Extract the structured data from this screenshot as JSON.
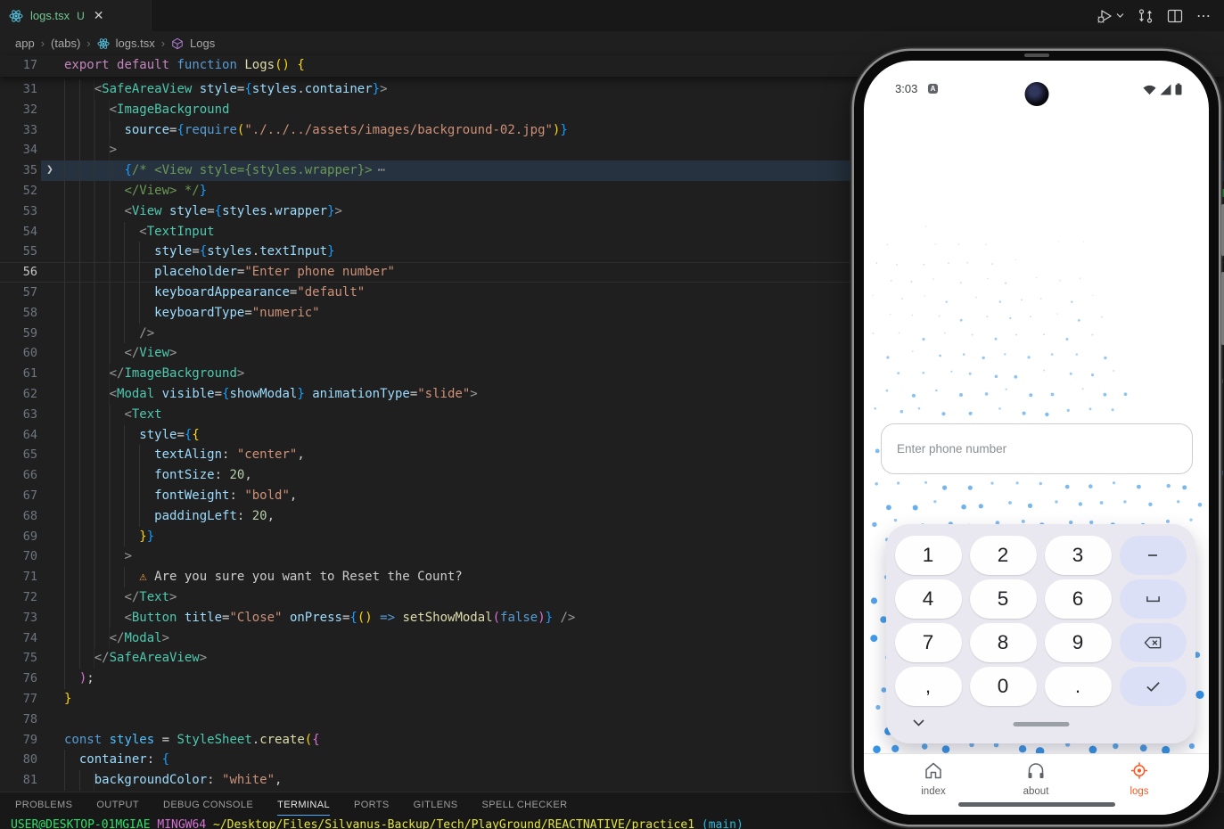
{
  "window": {
    "tab": {
      "title": "logs.tsx",
      "badge": "U",
      "close_glyph": "✕"
    },
    "editor_actions": [
      "run-or-debug",
      "open-changes",
      "split-editor",
      "more-actions"
    ]
  },
  "breadcrumb": {
    "items": [
      "app",
      "(tabs)",
      "logs.tsx",
      "Logs"
    ],
    "separator": "›"
  },
  "editor": {
    "sticky_line": {
      "n": 17,
      "t": [
        [
          "kw1",
          "export"
        ],
        [
          "pln",
          " "
        ],
        [
          "kw1",
          "default"
        ],
        [
          "pln",
          " "
        ],
        [
          "kw2",
          "function"
        ],
        [
          "pln",
          " "
        ],
        [
          "fn",
          "Logs"
        ],
        [
          "br1",
          "()"
        ],
        [
          "pln",
          " "
        ],
        [
          "br1",
          "{"
        ]
      ]
    },
    "lines": [
      {
        "n": 31,
        "t": [
          [
            "ws",
            "    "
          ],
          [
            "pun",
            "<"
          ],
          [
            "cmp",
            "SafeAreaView"
          ],
          [
            "pln",
            " "
          ],
          [
            "attr",
            "style"
          ],
          [
            "pln",
            "="
          ],
          [
            "br3",
            "{"
          ],
          [
            "var",
            "styles"
          ],
          [
            "pln",
            "."
          ],
          [
            "var",
            "container"
          ],
          [
            "br3",
            "}"
          ],
          [
            "pun",
            ">"
          ]
        ]
      },
      {
        "n": 32,
        "t": [
          [
            "ws",
            "      "
          ],
          [
            "pun",
            "<"
          ],
          [
            "cmp",
            "ImageBackground"
          ]
        ]
      },
      {
        "n": 33,
        "t": [
          [
            "ws",
            "        "
          ],
          [
            "attr",
            "source"
          ],
          [
            "pln",
            "="
          ],
          [
            "br3",
            "{"
          ],
          [
            "kw2",
            "require"
          ],
          [
            "br1",
            "("
          ],
          [
            "str",
            "\"./../../assets/images/background-02.jpg\""
          ],
          [
            "br1",
            ")"
          ],
          [
            "br3",
            "}"
          ]
        ]
      },
      {
        "n": 34,
        "t": [
          [
            "ws",
            "      "
          ],
          [
            "pun",
            ">"
          ]
        ]
      },
      {
        "n": 35,
        "f": true,
        "h": true,
        "t": [
          [
            "ws",
            "        "
          ],
          [
            "br3",
            "{"
          ],
          [
            "cmt",
            "/* <View style={styles.wrapper}>"
          ],
          [
            "fold",
            "⋯"
          ]
        ]
      },
      {
        "n": 52,
        "t": [
          [
            "ws",
            "        "
          ],
          [
            "cmt",
            "</View> */"
          ],
          [
            "br3",
            "}"
          ]
        ]
      },
      {
        "n": 53,
        "t": [
          [
            "ws",
            "        "
          ],
          [
            "pun",
            "<"
          ],
          [
            "cmp",
            "View"
          ],
          [
            "pln",
            " "
          ],
          [
            "attr",
            "style"
          ],
          [
            "pln",
            "="
          ],
          [
            "br3",
            "{"
          ],
          [
            "var",
            "styles"
          ],
          [
            "pln",
            "."
          ],
          [
            "var",
            "wrapper"
          ],
          [
            "br3",
            "}"
          ],
          [
            "pun",
            ">"
          ]
        ]
      },
      {
        "n": 54,
        "t": [
          [
            "ws",
            "          "
          ],
          [
            "pun",
            "<"
          ],
          [
            "cmp",
            "TextInput"
          ]
        ]
      },
      {
        "n": 55,
        "t": [
          [
            "ws",
            "            "
          ],
          [
            "attr",
            "style"
          ],
          [
            "pln",
            "="
          ],
          [
            "br3",
            "{"
          ],
          [
            "var",
            "styles"
          ],
          [
            "pln",
            "."
          ],
          [
            "var",
            "textInput"
          ],
          [
            "br3",
            "}"
          ]
        ]
      },
      {
        "n": 56,
        "c": true,
        "t": [
          [
            "ws",
            "            "
          ],
          [
            "attr",
            "placeholder"
          ],
          [
            "pln",
            "="
          ],
          [
            "str",
            "\"Enter phone number\""
          ]
        ]
      },
      {
        "n": 57,
        "t": [
          [
            "ws",
            "            "
          ],
          [
            "attr",
            "keyboardAppearance"
          ],
          [
            "pln",
            "="
          ],
          [
            "str",
            "\"default\""
          ]
        ]
      },
      {
        "n": 58,
        "t": [
          [
            "ws",
            "            "
          ],
          [
            "attr",
            "keyboardType"
          ],
          [
            "pln",
            "="
          ],
          [
            "str",
            "\"numeric\""
          ]
        ]
      },
      {
        "n": 59,
        "t": [
          [
            "ws",
            "          "
          ],
          [
            "pun",
            "/>"
          ]
        ]
      },
      {
        "n": 60,
        "t": [
          [
            "ws",
            "        "
          ],
          [
            "pun",
            "</"
          ],
          [
            "cmp",
            "View"
          ],
          [
            "pun",
            ">"
          ]
        ]
      },
      {
        "n": 61,
        "t": [
          [
            "ws",
            "      "
          ],
          [
            "pun",
            "</"
          ],
          [
            "cmp",
            "ImageBackground"
          ],
          [
            "pun",
            ">"
          ]
        ]
      },
      {
        "n": 62,
        "t": [
          [
            "ws",
            "      "
          ],
          [
            "pun",
            "<"
          ],
          [
            "cmp",
            "Modal"
          ],
          [
            "pln",
            " "
          ],
          [
            "attr",
            "visible"
          ],
          [
            "pln",
            "="
          ],
          [
            "br3",
            "{"
          ],
          [
            "var",
            "showModal"
          ],
          [
            "br3",
            "}"
          ],
          [
            "pln",
            " "
          ],
          [
            "attr",
            "animationType"
          ],
          [
            "pln",
            "="
          ],
          [
            "str",
            "\"slide\""
          ],
          [
            "pun",
            ">"
          ]
        ]
      },
      {
        "n": 63,
        "t": [
          [
            "ws",
            "        "
          ],
          [
            "pun",
            "<"
          ],
          [
            "cmp",
            "Text"
          ]
        ]
      },
      {
        "n": 64,
        "t": [
          [
            "ws",
            "          "
          ],
          [
            "attr",
            "style"
          ],
          [
            "pln",
            "="
          ],
          [
            "br3",
            "{"
          ],
          [
            "br1",
            "{"
          ]
        ]
      },
      {
        "n": 65,
        "t": [
          [
            "ws",
            "            "
          ],
          [
            "attr",
            "textAlign"
          ],
          [
            "pln",
            ": "
          ],
          [
            "str",
            "\"center\""
          ],
          [
            "pln",
            ","
          ]
        ]
      },
      {
        "n": 66,
        "t": [
          [
            "ws",
            "            "
          ],
          [
            "attr",
            "fontSize"
          ],
          [
            "pln",
            ": "
          ],
          [
            "num",
            "20"
          ],
          [
            "pln",
            ","
          ]
        ]
      },
      {
        "n": 67,
        "t": [
          [
            "ws",
            "            "
          ],
          [
            "attr",
            "fontWeight"
          ],
          [
            "pln",
            ": "
          ],
          [
            "str",
            "\"bold\""
          ],
          [
            "pln",
            ","
          ]
        ]
      },
      {
        "n": 68,
        "t": [
          [
            "ws",
            "            "
          ],
          [
            "attr",
            "paddingLeft"
          ],
          [
            "pln",
            ": "
          ],
          [
            "num",
            "20"
          ],
          [
            "pln",
            ","
          ]
        ]
      },
      {
        "n": 69,
        "t": [
          [
            "ws",
            "          "
          ],
          [
            "br1",
            "}"
          ],
          [
            "br3",
            "}"
          ]
        ]
      },
      {
        "n": 70,
        "t": [
          [
            "ws",
            "        "
          ],
          [
            "pun",
            ">"
          ]
        ]
      },
      {
        "n": 71,
        "t": [
          [
            "ws",
            "          "
          ],
          [
            "emoji",
            "⚠"
          ],
          [
            "pln",
            " Are you sure you want to Reset the Count?"
          ]
        ]
      },
      {
        "n": 72,
        "t": [
          [
            "ws",
            "        "
          ],
          [
            "pun",
            "</"
          ],
          [
            "cmp",
            "Text"
          ],
          [
            "pun",
            ">"
          ]
        ]
      },
      {
        "n": 73,
        "t": [
          [
            "ws",
            "        "
          ],
          [
            "pun",
            "<"
          ],
          [
            "cmp",
            "Button"
          ],
          [
            "pln",
            " "
          ],
          [
            "attr",
            "title"
          ],
          [
            "pln",
            "="
          ],
          [
            "str",
            "\"Close\""
          ],
          [
            "pln",
            " "
          ],
          [
            "attr",
            "onPress"
          ],
          [
            "pln",
            "="
          ],
          [
            "br3",
            "{"
          ],
          [
            "br1",
            "("
          ],
          [
            "br1",
            ")"
          ],
          [
            "pln",
            " "
          ],
          [
            "kw2",
            "=>"
          ],
          [
            "pln",
            " "
          ],
          [
            "fn",
            "setShowModal"
          ],
          [
            "br2",
            "("
          ],
          [
            "kw2",
            "false"
          ],
          [
            "br2",
            ")"
          ],
          [
            "br3",
            "}"
          ],
          [
            "pln",
            " "
          ],
          [
            "pun",
            "/>"
          ]
        ]
      },
      {
        "n": 74,
        "t": [
          [
            "ws",
            "      "
          ],
          [
            "pun",
            "</"
          ],
          [
            "cmp",
            "Modal"
          ],
          [
            "pun",
            ">"
          ]
        ]
      },
      {
        "n": 75,
        "t": [
          [
            "ws",
            "    "
          ],
          [
            "pun",
            "</"
          ],
          [
            "cmp",
            "SafeAreaView"
          ],
          [
            "pun",
            ">"
          ]
        ]
      },
      {
        "n": 76,
        "t": [
          [
            "ws",
            "  "
          ],
          [
            "br2",
            ")"
          ],
          [
            "pln",
            ";"
          ]
        ]
      },
      {
        "n": 77,
        "t": [
          [
            "br1",
            "}"
          ]
        ]
      },
      {
        "n": 78,
        "t": []
      },
      {
        "n": 79,
        "t": [
          [
            "kw2",
            "const"
          ],
          [
            "pln",
            " "
          ],
          [
            "vardef",
            "styles"
          ],
          [
            "pln",
            " = "
          ],
          [
            "cmp",
            "StyleSheet"
          ],
          [
            "pln",
            "."
          ],
          [
            "fn",
            "create"
          ],
          [
            "br1",
            "("
          ],
          [
            "br2",
            "{"
          ]
        ]
      },
      {
        "n": 80,
        "t": [
          [
            "ws",
            "  "
          ],
          [
            "attr",
            "container"
          ],
          [
            "pln",
            ": "
          ],
          [
            "br3",
            "{"
          ]
        ]
      },
      {
        "n": 81,
        "t": [
          [
            "ws",
            "    "
          ],
          [
            "attr",
            "backgroundColor"
          ],
          [
            "pln",
            ": "
          ],
          [
            "str",
            "\"white\""
          ],
          [
            "pln",
            ","
          ]
        ]
      }
    ]
  },
  "panel": {
    "tabs": [
      {
        "label": "PROBLEMS"
      },
      {
        "label": "OUTPUT"
      },
      {
        "label": "DEBUG CONSOLE"
      },
      {
        "label": "TERMINAL",
        "active": true
      },
      {
        "label": "PORTS"
      },
      {
        "label": "GITLENS"
      },
      {
        "label": "SPELL CHECKER"
      }
    ],
    "terminal_line": [
      [
        "tgreen",
        "USER@DESKTOP-01MGIAE"
      ],
      [
        "tplain",
        " "
      ],
      [
        "tmagenta",
        "MINGW64"
      ],
      [
        "tplain",
        " "
      ],
      [
        "tyellow",
        "~/Desktop/Files/Silvanus-Backup/Tech/PlayGround/REACTNATIVE/practice1"
      ],
      [
        "tplain",
        " "
      ],
      [
        "tcyan",
        "(main)"
      ]
    ]
  },
  "phone": {
    "status": {
      "time": "3:03",
      "notification_letter": "A"
    },
    "input": {
      "placeholder": "Enter phone number"
    },
    "keypad": {
      "rows": [
        [
          {
            "t": "1"
          },
          {
            "t": "2"
          },
          {
            "t": "3"
          },
          {
            "icon": "minus",
            "accent": true
          }
        ],
        [
          {
            "t": "4"
          },
          {
            "t": "5"
          },
          {
            "t": "6"
          },
          {
            "icon": "space",
            "accent": true
          }
        ],
        [
          {
            "t": "7"
          },
          {
            "t": "8"
          },
          {
            "t": "9"
          },
          {
            "icon": "backspace",
            "accent": true
          }
        ],
        [
          {
            "t": ","
          },
          {
            "t": "0"
          },
          {
            "t": "."
          },
          {
            "icon": "enter",
            "accent": true
          }
        ]
      ]
    },
    "nav": [
      {
        "label": "index"
      },
      {
        "label": "about"
      },
      {
        "label": "logs",
        "active": true
      }
    ]
  },
  "colors": {
    "accent_blue": "#4daafc",
    "untracked_green": "#73c991",
    "logs_orange": "#ff5722",
    "dot_blue": "#1e88e5",
    "keypad_bg": "#e9e8f0",
    "key_accent": "#dbe0f7",
    "editor_bg": "#1f1f1f",
    "panel_bg": "#181818",
    "folded_line_highlight": "#263240"
  }
}
